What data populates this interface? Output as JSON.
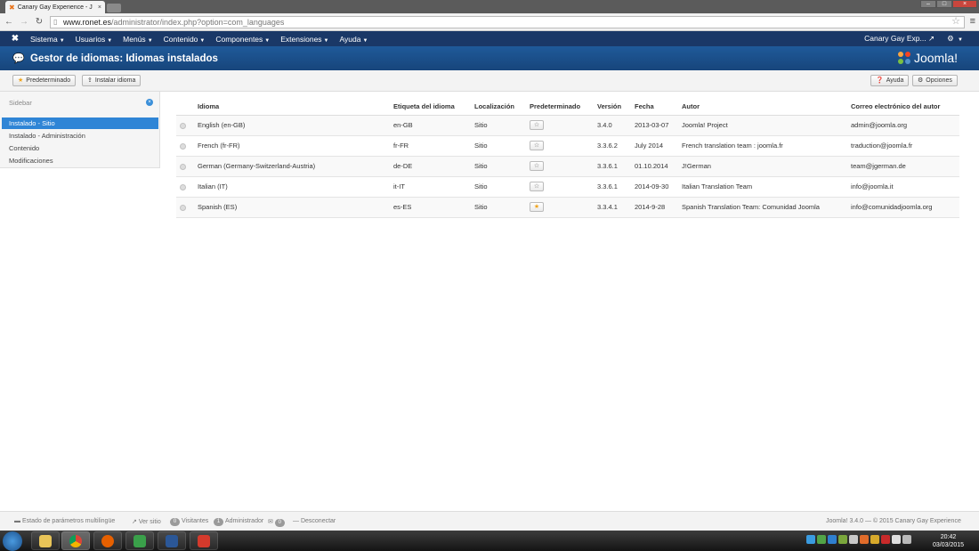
{
  "browser": {
    "tab_title": "Canary Gay Experience - J",
    "url_host": "www.ronet.es",
    "url_path": "/administrator/index.php?option=com_languages"
  },
  "topnav": {
    "items": [
      "Sistema",
      "Usuarios",
      "Menús",
      "Contenido",
      "Componentes",
      "Extensiones",
      "Ayuda"
    ],
    "site_name": "Canary Gay Exp..."
  },
  "page": {
    "title": "Gestor de idiomas: Idiomas instalados",
    "brand": "Joomla!"
  },
  "toolbar": {
    "default_label": "Predeterminado",
    "install_label": "Instalar idioma",
    "help_label": "Ayuda",
    "options_label": "Opciones"
  },
  "sidebar": {
    "heading": "Sidebar",
    "items": [
      "Instalado - Sitio",
      "Instalado - Administración",
      "Contenido",
      "Modificaciones"
    ],
    "active_index": 0
  },
  "table": {
    "headers": [
      "Idioma",
      "Etiqueta del idioma",
      "Localización",
      "Predeterminado",
      "Versión",
      "Fecha",
      "Autor",
      "Correo electrónico del autor"
    ],
    "rows": [
      {
        "language": "English (en-GB)",
        "tag": "en-GB",
        "location": "Sitio",
        "default": false,
        "version": "3.4.0",
        "date": "2013-03-07",
        "author": "Joomla! Project",
        "email": "admin@joomla.org"
      },
      {
        "language": "French (fr-FR)",
        "tag": "fr-FR",
        "location": "Sitio",
        "default": false,
        "version": "3.3.6.2",
        "date": "July 2014",
        "author": "French translation team : joomla.fr",
        "email": "traduction@joomla.fr"
      },
      {
        "language": "German (Germany-Switzerland-Austria)",
        "tag": "de-DE",
        "location": "Sitio",
        "default": false,
        "version": "3.3.6.1",
        "date": "01.10.2014",
        "author": "J!German",
        "email": "team@jgerman.de"
      },
      {
        "language": "Italian (IT)",
        "tag": "it-IT",
        "location": "Sitio",
        "default": false,
        "version": "3.3.6.1",
        "date": "2014-09-30",
        "author": "Italian Translation Team",
        "email": "info@joomla.it"
      },
      {
        "language": "Spanish (ES)",
        "tag": "es-ES",
        "location": "Sitio",
        "default": true,
        "version": "3.3.4.1",
        "date": "2014-9-28",
        "author": "Spanish Translation Team: Comunidad Joomla",
        "email": "info@comunidadjoomla.org"
      }
    ]
  },
  "status": {
    "multilang": "Estado de parámetros multilingüe",
    "view_site": "Ver sitio",
    "visitors_count": "0",
    "visitors_label": "Visitantes",
    "admin_count": "1",
    "admin_label": "Administrador",
    "messages_count": "0",
    "logout": "Desconectar",
    "copyright": "Joomla! 3.4.0 — © 2015 Canary Gay Experience"
  },
  "taskbar": {
    "time": "20:42",
    "date": "03/03/2015"
  },
  "colors": {
    "nav_bg": "#1a3867",
    "title_bg": "#1f5a9a",
    "active_item": "#2f85d6",
    "default_star": "#f0a31a"
  }
}
